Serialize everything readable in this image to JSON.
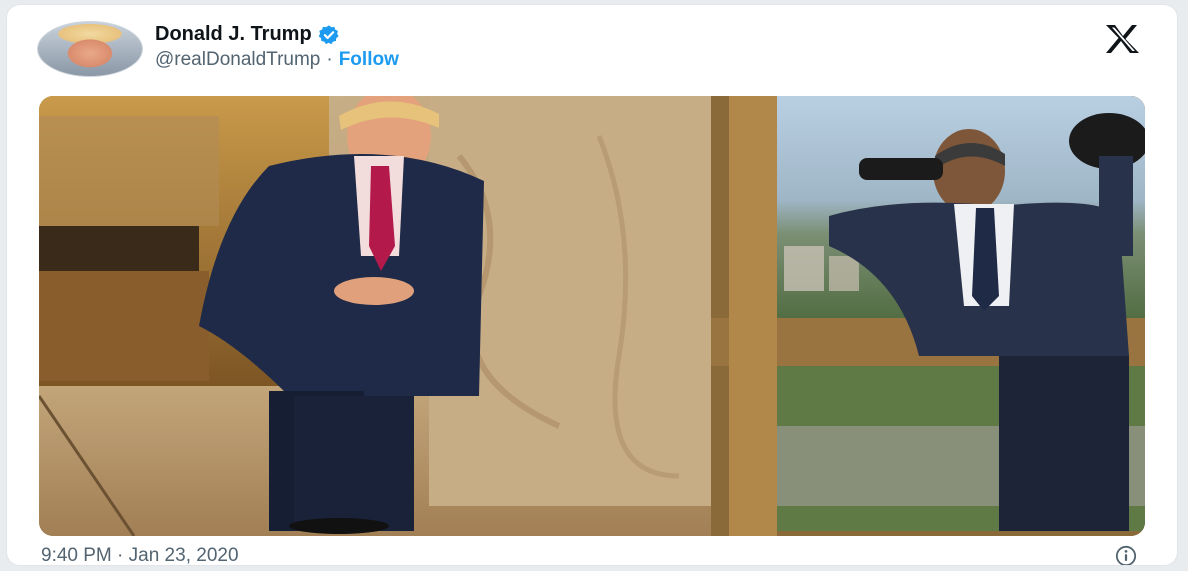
{
  "author": {
    "display_name": "Donald J. Trump",
    "handle": "@realDonaldTrump",
    "separator": "·",
    "follow_label": "Follow"
  },
  "footer": {
    "timestamp": "9:40 PM · Jan 23, 2020"
  },
  "icons": {
    "verified": "verified-badge-icon",
    "platform": "x-logo-icon",
    "info": "info-icon"
  },
  "colors": {
    "accent": "#1d9bf0",
    "text_primary": "#0f1419",
    "text_secondary": "#536471"
  }
}
